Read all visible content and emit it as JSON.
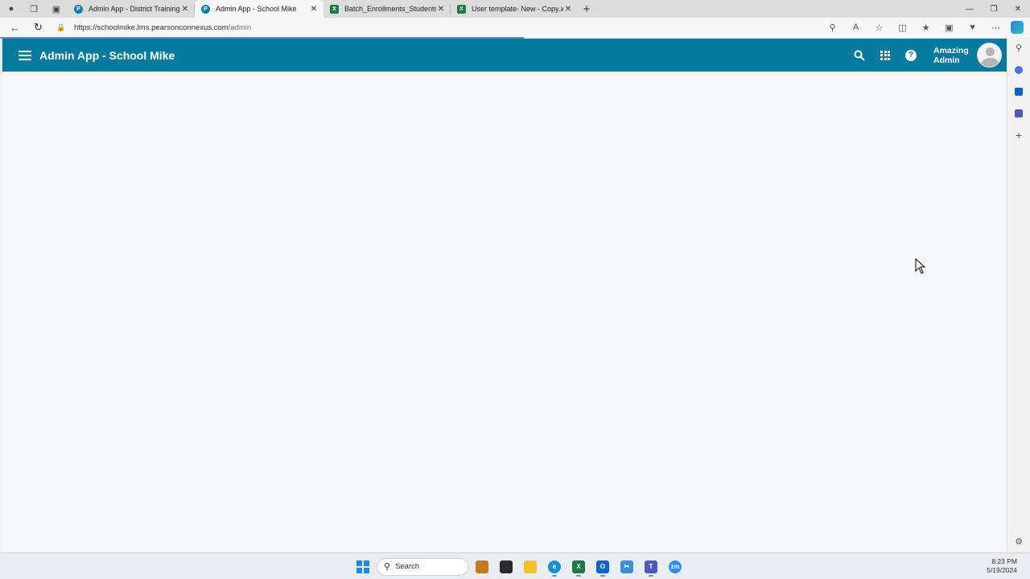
{
  "browser": {
    "tabs": [
      {
        "title": "Admin App - District Training",
        "type": "pearson",
        "active": false
      },
      {
        "title": "Admin App - School Mike",
        "type": "pearson",
        "active": true
      },
      {
        "title": "Batch_Enrollments_Students_sks",
        "type": "excel",
        "active": false
      },
      {
        "title": "User template- New - Copy.xlsx",
        "type": "excel",
        "active": false
      }
    ],
    "url_host": "https://schoolmike.lms.pearsonconnexus.com",
    "url_path": "/admin",
    "load_progress": 0.52
  },
  "app": {
    "title": "Admin App - School Mike",
    "user_name_line1": "Amazing",
    "user_name_line2": "Admin",
    "header_color": "#047b9c"
  },
  "taskbar": {
    "search_label": "Search",
    "time": "8:23 PM",
    "date": "5/19/2024"
  }
}
